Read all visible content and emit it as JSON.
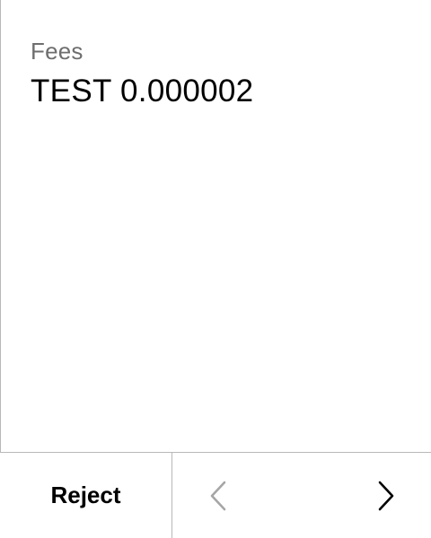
{
  "fees": {
    "label": "Fees",
    "value": "TEST 0.000002"
  },
  "footer": {
    "reject_label": "Reject",
    "prev_icon": "chevron-left-icon",
    "next_icon": "chevron-right-icon",
    "prev_enabled": false,
    "next_enabled": true,
    "disabled_color": "#a6a6a6",
    "enabled_color": "#000000"
  }
}
